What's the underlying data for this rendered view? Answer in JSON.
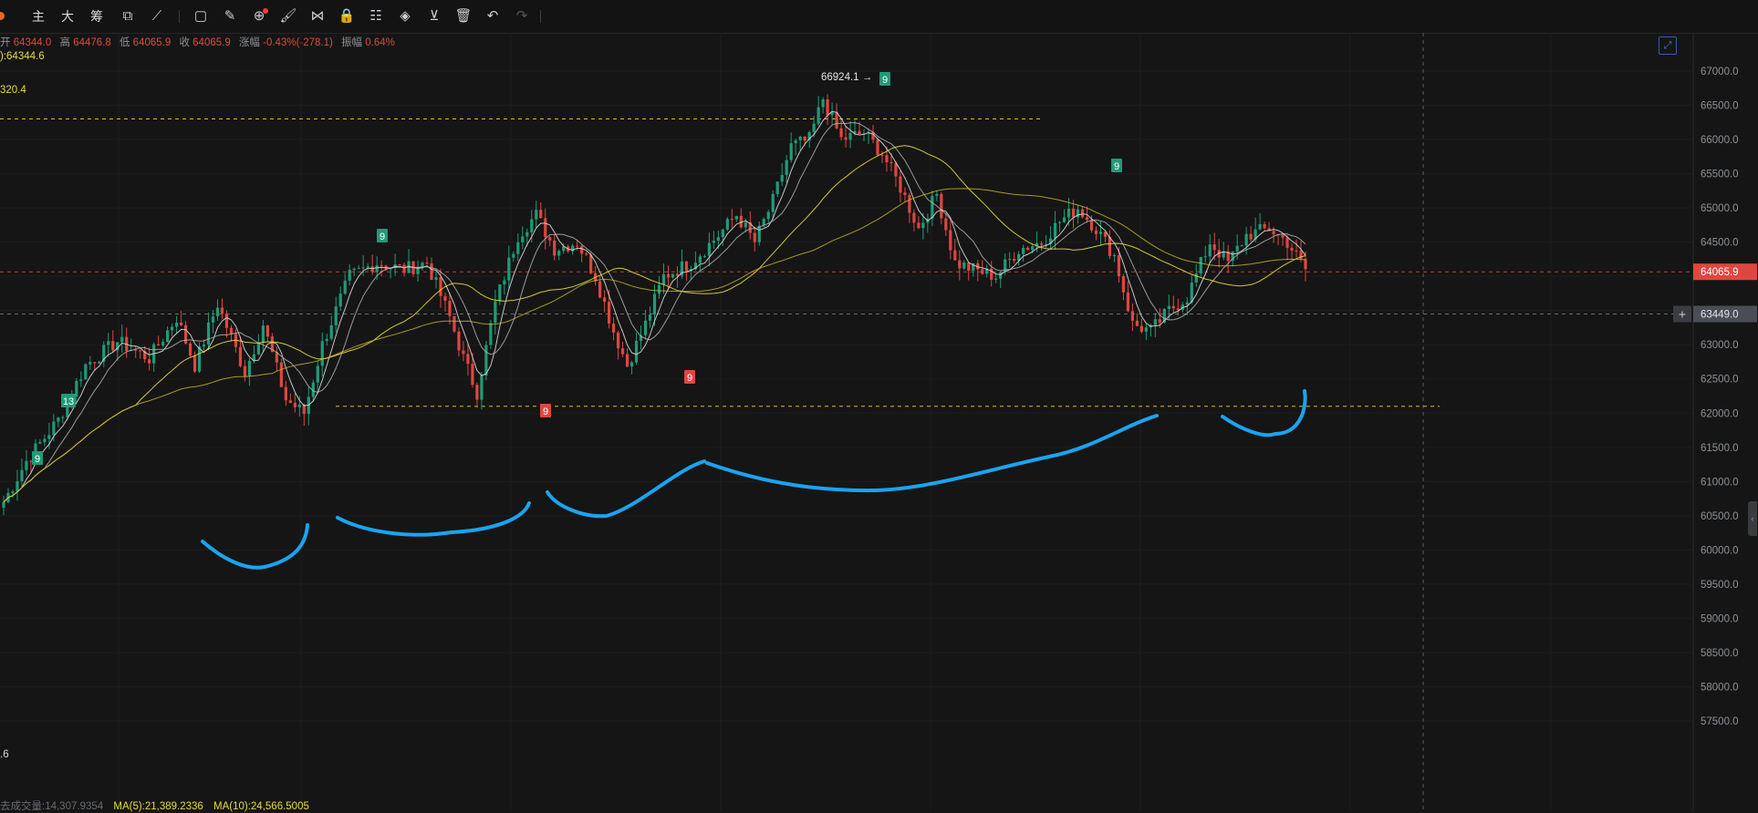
{
  "toolbar": {
    "items": [
      {
        "icon": "主",
        "name": "main-indicator"
      },
      {
        "icon": "大",
        "name": "big-order"
      },
      {
        "icon": "筹",
        "name": "chip-distribution"
      },
      {
        "icon": "⧉",
        "name": "compare-icon"
      },
      {
        "icon": "⟋",
        "name": "trend-line-icon"
      },
      {
        "icon": "▢",
        "name": "copy-icon"
      },
      {
        "icon": "✎",
        "name": "ruler-icon"
      },
      {
        "icon": "⊕",
        "name": "zoom-icon"
      },
      {
        "icon": "🖌",
        "name": "brush-icon"
      },
      {
        "icon": "⋈",
        "name": "pattern-icon"
      },
      {
        "icon": "🔒",
        "name": "lock-icon"
      },
      {
        "icon": "☷",
        "name": "template-icon"
      },
      {
        "icon": "◈",
        "name": "magnet-icon"
      },
      {
        "icon": "⊻",
        "name": "filter-icon"
      },
      {
        "icon": "🗑",
        "name": "trash-icon"
      },
      {
        "icon": "↶",
        "name": "undo-icon"
      },
      {
        "icon": "↷",
        "name": "redo-icon"
      }
    ]
  },
  "ohlc": {
    "open_label": "开",
    "open": "64344.0",
    "high_label": "高",
    "high": "64476.8",
    "low_label": "低",
    "low": "64065.9",
    "close_label": "收",
    "close": "64065.9",
    "change_label": "涨幅",
    "change": "-0.43%(-278.1)",
    "amplitude_label": "振幅",
    "amplitude": "0.64%"
  },
  "ma_legend": {
    "line1": "):64344.6",
    "line2": "320.4"
  },
  "left_partial_label": ".6",
  "volume_legend": {
    "volume": "去成交量:14,307.9354",
    "ma5": "MA(5):21,389.2336",
    "ma10": "MA(10):24,566.5005"
  },
  "price_axis": {
    "labels": [
      "67000.0",
      "66500.0",
      "66000.0",
      "65500.0",
      "65000.0",
      "64500.0",
      "64000.0",
      "63500.0",
      "63000.0",
      "62500.0",
      "62000.0",
      "61500.0",
      "61000.0",
      "60500.0",
      "60000.0",
      "59500.0",
      "59000.0",
      "58500.0",
      "58000.0",
      "57500.0"
    ],
    "last_price": "64065.9",
    "crosshair_price": "63449.0"
  },
  "annotations": {
    "peak_label": "66924.1 →",
    "td_markers": [
      {
        "text": "9",
        "kind": "up"
      },
      {
        "text": "13",
        "kind": "up"
      },
      {
        "text": "9",
        "kind": "up"
      },
      {
        "text": "9",
        "kind": "down"
      },
      {
        "text": "9",
        "kind": "down"
      },
      {
        "text": "9",
        "kind": "up"
      },
      {
        "text": "9",
        "kind": "up"
      }
    ]
  },
  "colors": {
    "background": "#151515",
    "up": "#1f9b78",
    "down": "#e0463f",
    "ma_yellow": "#e6dd35",
    "ma_white": "#d8d8d8",
    "hand_drawn": "#1aa4f0",
    "level_line": "#e6b422",
    "last_price_line": "#e0463f"
  }
}
